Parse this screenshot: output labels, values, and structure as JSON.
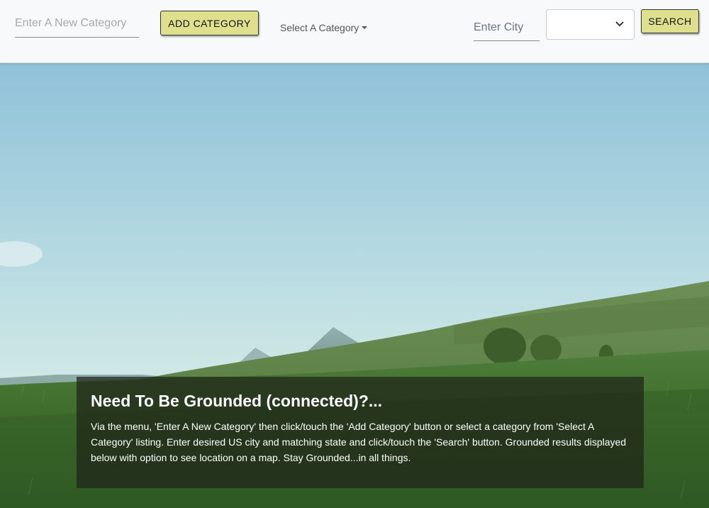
{
  "navbar": {
    "category_input": {
      "placeholder": "Enter A New Category",
      "value": ""
    },
    "add_category_label": "ADD CATEGORY",
    "select_category_label": "Select A Category",
    "city_input": {
      "placeholder": "Enter City",
      "value": ""
    },
    "state_select": {
      "selected": ""
    },
    "search_label": "SEARCH",
    "button_color": "#dfe08e"
  },
  "hero": {
    "heading": "Need To Be Grounded (connected)?...",
    "body": "Via the menu, 'Enter A New Category' then click/touch the 'Add Category' button or select a category from 'Select A Category' listing. Enter desired US city and matching state and click/touch the 'Search' button. Grounded results displayed below with option to see location on a map. Stay Grounded...in all things."
  },
  "icons": {
    "dropdown_caret": "caret-down-icon",
    "select_chevron": "chevron-down-icon"
  }
}
